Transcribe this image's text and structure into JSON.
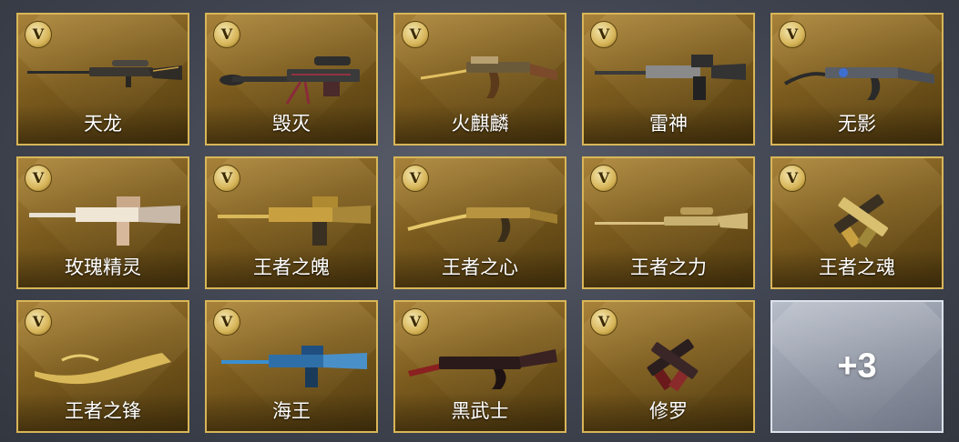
{
  "badge_letter": "V",
  "items": [
    {
      "name": "天龙",
      "weapon": "sniper-rifle"
    },
    {
      "name": "毁灭",
      "weapon": "heavy-sniper-rifle"
    },
    {
      "name": "火麒麟",
      "weapon": "assault-rifle-ak"
    },
    {
      "name": "雷神",
      "weapon": "assault-rifle-m4"
    },
    {
      "name": "无影",
      "weapon": "assault-rifle-ak"
    },
    {
      "name": "玫瑰精灵",
      "weapon": "assault-rifle-m4"
    },
    {
      "name": "王者之魄",
      "weapon": "assault-rifle-m4"
    },
    {
      "name": "王者之心",
      "weapon": "assault-rifle-ak"
    },
    {
      "name": "王者之力",
      "weapon": "sniper-rifle"
    },
    {
      "name": "王者之魂",
      "weapon": "dual-pistols"
    },
    {
      "name": "王者之锋",
      "weapon": "melee-blade"
    },
    {
      "name": "海王",
      "weapon": "assault-rifle-m4"
    },
    {
      "name": "黑武士",
      "weapon": "assault-rifle-ak"
    },
    {
      "name": "修罗",
      "weapon": "dual-pistols"
    }
  ],
  "more": {
    "label": "+3"
  },
  "colors": {
    "gold_card": "#8a6a28",
    "gold_border": "#d8b658",
    "silver_card": "#9aa0ad",
    "page_bg": "#454a55"
  }
}
